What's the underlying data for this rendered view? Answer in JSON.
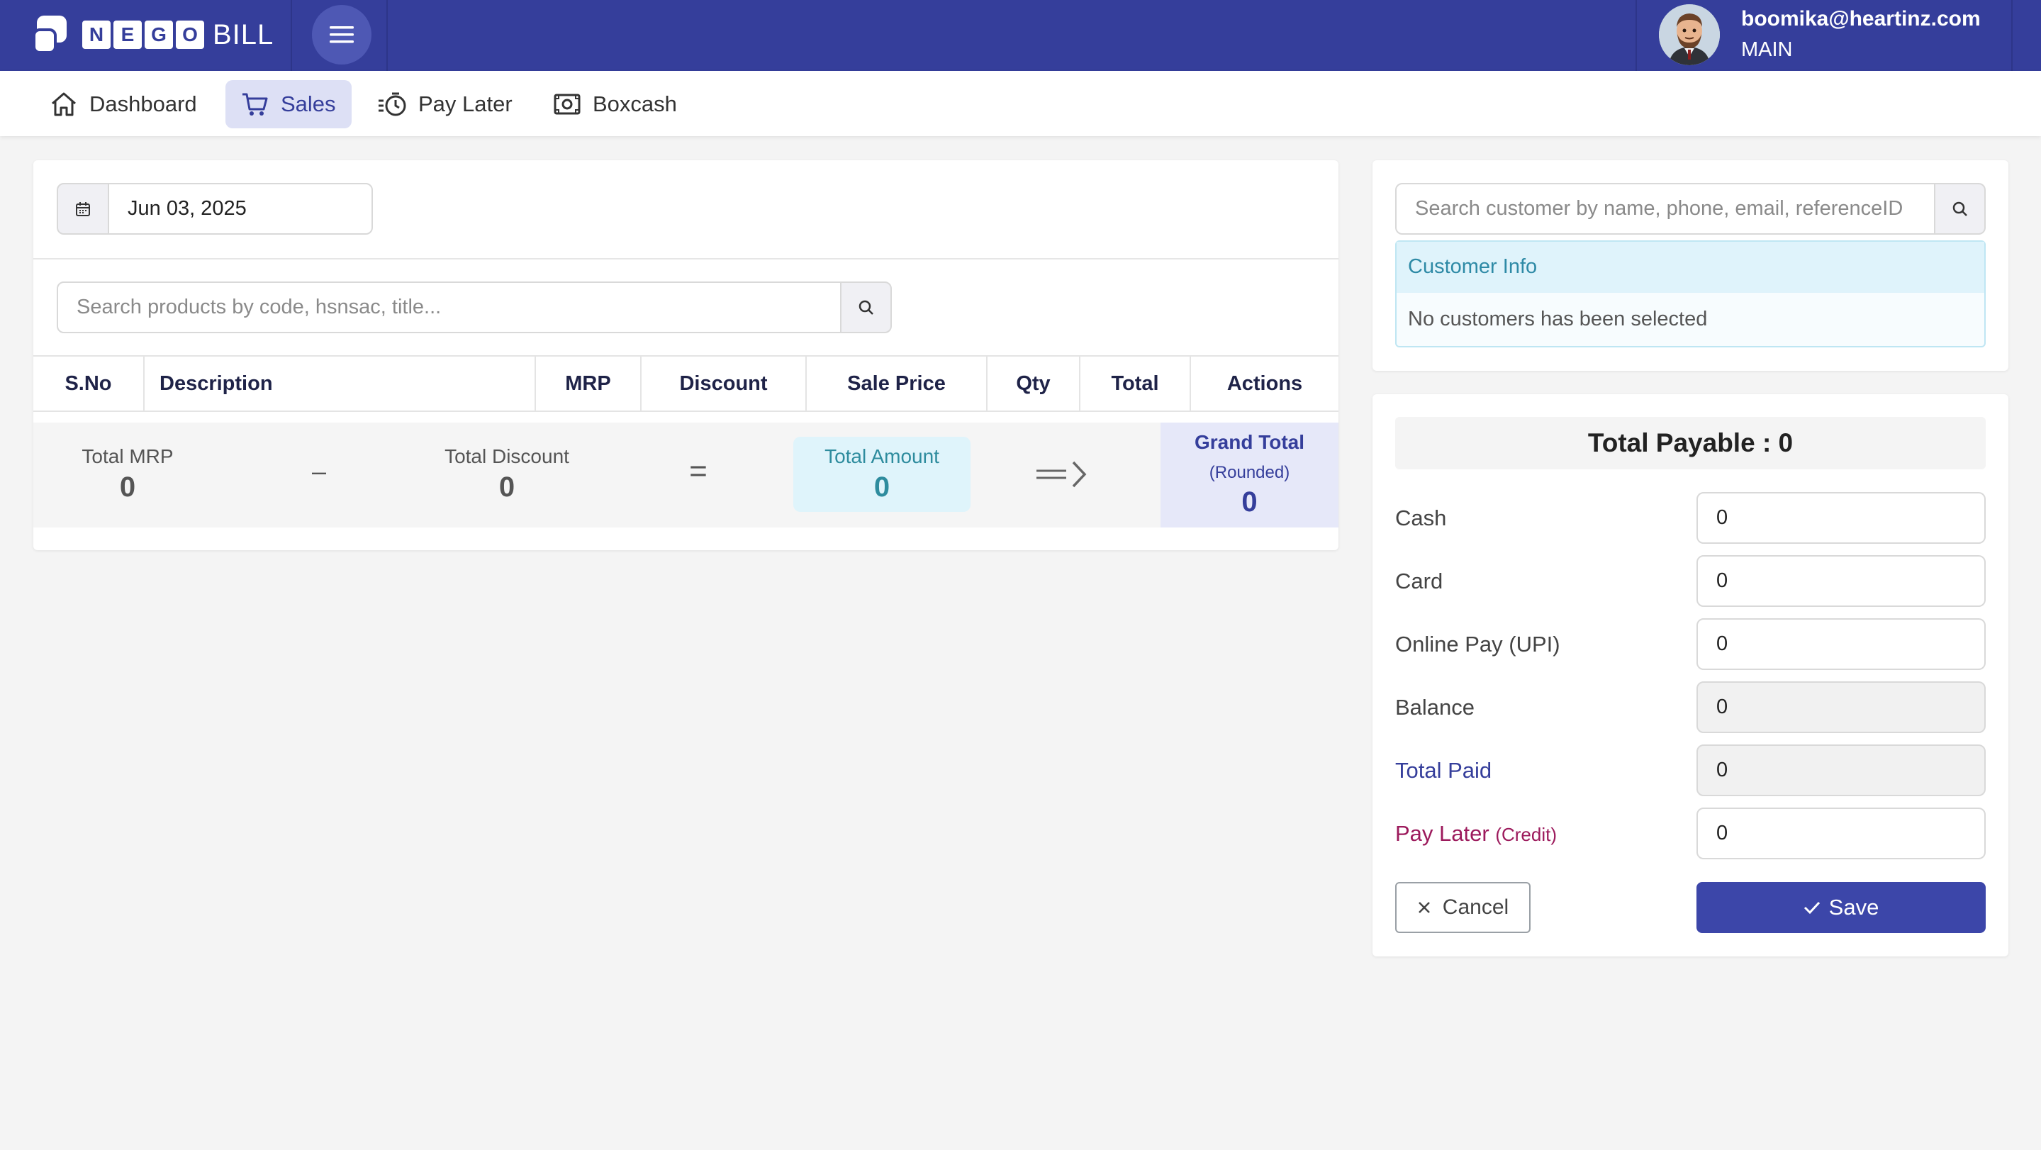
{
  "brand": {
    "logo_letters": [
      "N",
      "E",
      "G",
      "O"
    ],
    "logo_suffix": "BILL",
    "primary_color": "#353e9b",
    "accent_color": "#3c46a9"
  },
  "header": {
    "menu_icon": "hamburger-icon",
    "user_email": "boomika@heartinz.com",
    "branch": "MAIN"
  },
  "nav": {
    "items": [
      {
        "label": "Dashboard",
        "icon": "home-icon",
        "active": false
      },
      {
        "label": "Sales",
        "icon": "cart-icon",
        "active": true
      },
      {
        "label": "Pay Later",
        "icon": "timer-icon",
        "active": false
      },
      {
        "label": "Boxcash",
        "icon": "cash-icon",
        "active": false
      }
    ]
  },
  "sale": {
    "date": "Jun 03, 2025",
    "product_search_placeholder": "Search products by code, hsnsac, title...",
    "table_headers": [
      "S.No",
      "Description",
      "MRP",
      "Discount",
      "Sale Price",
      "Qty",
      "Total",
      "Actions"
    ],
    "rows": []
  },
  "summary": {
    "total_mrp_label": "Total MRP",
    "total_mrp": "0",
    "minus_symbol": "–",
    "total_discount_label": "Total Discount",
    "total_discount": "0",
    "equals_symbol": "=",
    "total_amount_label": "Total Amount",
    "total_amount": "0",
    "grand_total_label": "Grand Total",
    "grand_total_sub": "(Rounded)",
    "grand_total": "0"
  },
  "customer": {
    "search_placeholder": "Search customer by name, phone, email, referenceID",
    "info_title": "Customer Info",
    "info_empty": "No customers has been selected"
  },
  "payment": {
    "title": "Total Payable : 0",
    "cash_label": "Cash",
    "cash": "0",
    "card_label": "Card",
    "card": "0",
    "upi_label": "Online Pay (UPI)",
    "upi": "0",
    "balance_label": "Balance",
    "balance": "0",
    "total_paid_label": "Total Paid",
    "total_paid": "0",
    "pay_later_label": "Pay Later",
    "pay_later_sub": "(Credit)",
    "pay_later": "0",
    "cancel_label": "Cancel",
    "save_label": "Save"
  }
}
